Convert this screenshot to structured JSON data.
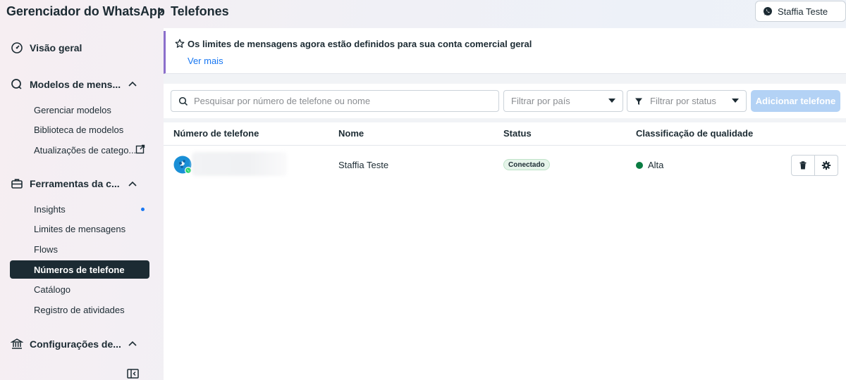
{
  "header": {
    "breadcrumb_root": "Gerenciador do WhatsApp",
    "breadcrumb_page": "Telefones",
    "account_name": "Staffia Teste"
  },
  "sidebar": {
    "overview": "Visão geral",
    "templates_section": "Modelos de mens...",
    "templates_items": [
      "Gerenciar modelos",
      "Biblioteca de modelos",
      "Atualizações de catego..."
    ],
    "tools_section": "Ferramentas da c...",
    "tools_items": [
      "Insights",
      "Limites de mensagens",
      "Flows",
      "Números de telefone",
      "Catálogo",
      "Registro de atividades"
    ],
    "settings_section": "Configurações de...",
    "active_item": "Números de telefone"
  },
  "banner": {
    "title": "Os limites de mensagens agora estão definidos para sua conta comercial geral",
    "link": "Ver mais"
  },
  "filters": {
    "search_placeholder": "Pesquisar por número de telefone ou nome",
    "country_placeholder": "Filtrar por país",
    "status_placeholder": "Filtrar por status",
    "add_button": "Adicionar telefone"
  },
  "table": {
    "columns": [
      "Número de telefone",
      "Nome",
      "Status",
      "Classificação de qualidade"
    ],
    "rows": [
      {
        "phone": "",
        "name": "Staffia Teste",
        "status": "Conectado",
        "quality": "Alta"
      }
    ]
  },
  "colors": {
    "accent": "#1877f2",
    "nav_active": "#1c2b33",
    "banner_border": "#8b6fcb",
    "quality_high": "#0a7c42",
    "status_badge": "#e6f4ea"
  },
  "icons": [
    "chevron-right-icon",
    "whatsapp-icon",
    "overview-icon",
    "chat-icon",
    "chevron-up-icon",
    "external-link-icon",
    "briefcase-icon",
    "bank-icon",
    "collapse-sidebar-icon",
    "star-icon",
    "search-icon",
    "filter-icon",
    "caret-down-icon",
    "avatar-icon",
    "trash-icon",
    "gear-icon"
  ]
}
